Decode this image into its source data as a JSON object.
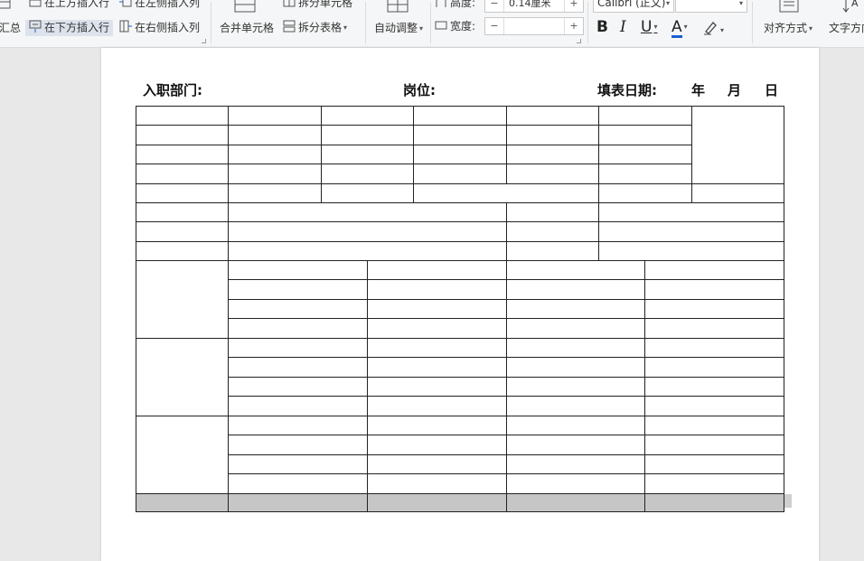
{
  "ribbon": {
    "insert_above": "在上方插入行",
    "insert_below": "在下方插入行",
    "insert_left": "在左侧插入列",
    "insert_right": "在右侧插入列",
    "summary_partial": "汇总",
    "merge_cells": "合并单元格",
    "split_cells": "拆分单元格",
    "split_table": "拆分表格",
    "auto_fit": "自动调整",
    "height_label": "高度:",
    "height_value": "0.14厘米",
    "width_label": "宽度:",
    "width_value": "",
    "font_name": "Calibri (正文)",
    "font_size": "",
    "bold": "B",
    "italic": "I",
    "underline": "U",
    "font_color": "A",
    "align_label": "对齐方式",
    "text_direction": "文字方向"
  },
  "document": {
    "dept_label": "入职部门:",
    "position_label": "岗位:",
    "date_label": "填表日期:",
    "year": "年",
    "month": "月",
    "day": "日"
  },
  "colors": {
    "font_color_bar": "#1a5fd0",
    "selection_gray": "#c6c6c6",
    "ribbon_bg": "#f5f6f7"
  }
}
